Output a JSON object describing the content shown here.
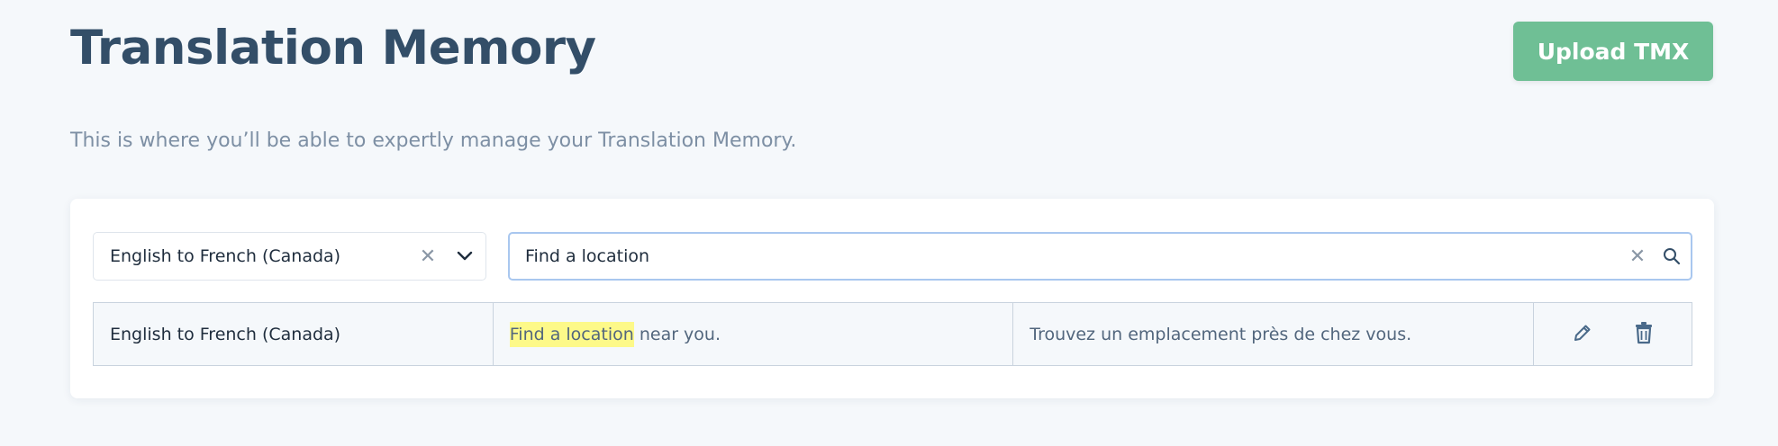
{
  "header": {
    "title": "Translation Memory",
    "upload_label": "Upload TMX",
    "subtitle": "This is where you’ll be able to expertly manage your Translation Memory."
  },
  "filters": {
    "language_pair": "English to French (Canada)",
    "search_value": "Find a location"
  },
  "entries": [
    {
      "language_pair": "English to French (Canada)",
      "source_match": "Find a location",
      "source_rest": " near you.",
      "target": "Trouvez un emplacement près de chez vous."
    }
  ],
  "icons": {
    "clear": "close-icon",
    "dropdown": "chevron-down-icon",
    "search": "search-icon",
    "edit": "pencil-icon",
    "delete": "trash-icon"
  },
  "colors": {
    "accent_green": "#6fbf95",
    "highlight": "#fdf989",
    "title": "#334e68"
  }
}
